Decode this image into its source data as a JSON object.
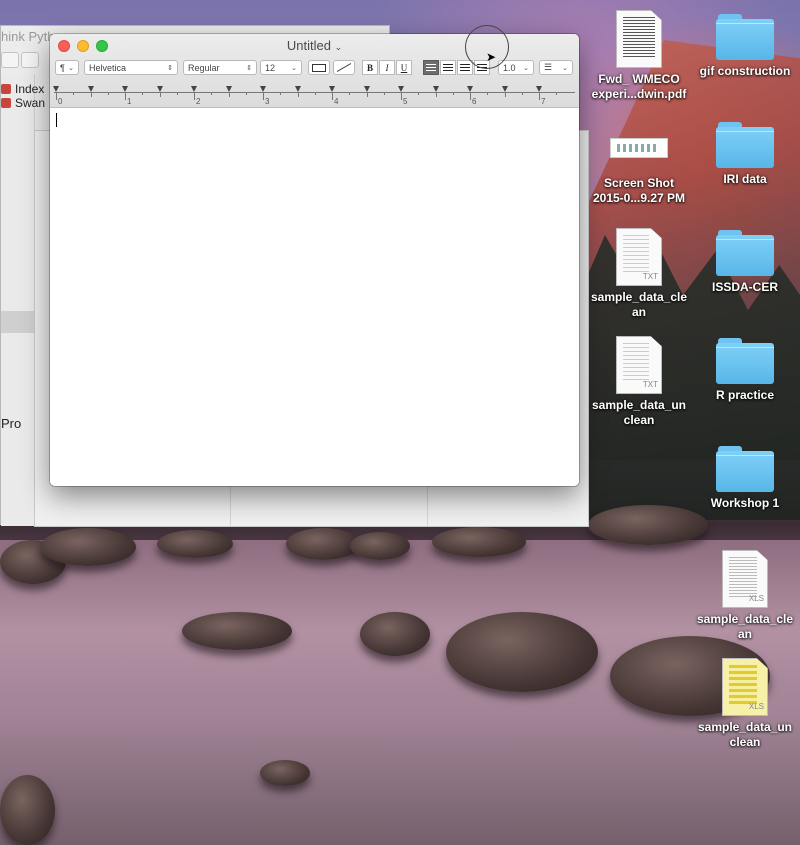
{
  "background_window": {
    "title": "hink Pytho",
    "sidebar_items": [
      "Index",
      "Swan"
    ],
    "footer_text": "Pro"
  },
  "textedit": {
    "title": "Untitled",
    "paragraph_style_label": "¶",
    "font_family": "Helvetica",
    "font_style": "Regular",
    "font_size": "12",
    "bold_label": "B",
    "italic_label": "I",
    "underline_label": "U",
    "line_spacing": "1.0",
    "ruler_numbers": [
      "0",
      "1",
      "2",
      "3",
      "4",
      "5",
      "6",
      "7"
    ]
  },
  "desktop_icons": [
    {
      "label_1": "Fwd_ WMECO",
      "label_2": "experi...dwin.pdf",
      "kind": "pdf-document-icon"
    },
    {
      "label_1": "gif construction",
      "label_2": "",
      "kind": "folder-icon"
    },
    {
      "label_1": "Screen Shot",
      "label_2": "2015-0...9.27 PM",
      "kind": "screenshot-icon"
    },
    {
      "label_1": "IRI data",
      "label_2": "",
      "kind": "folder-icon"
    },
    {
      "label_1": "sample_data_cle",
      "label_2": "an",
      "kind": "txt-document-icon",
      "badge": "TXT"
    },
    {
      "label_1": "ISSDA-CER",
      "label_2": "",
      "kind": "folder-icon"
    },
    {
      "label_1": "sample_data_un",
      "label_2": "clean",
      "kind": "txt-document-icon",
      "badge": "TXT"
    },
    {
      "label_1": "R practice",
      "label_2": "",
      "kind": "folder-icon"
    },
    {
      "label_1": "Workshop 1",
      "label_2": "",
      "kind": "folder-icon"
    },
    {
      "label_1": "sample_data_cle",
      "label_2": "an",
      "kind": "xls-document-icon",
      "badge": "XLS"
    },
    {
      "label_1": "sample_data_un",
      "label_2": "clean",
      "kind": "xls-document-icon",
      "badge": "XLS"
    }
  ],
  "colors": {
    "traffic_close": "#fc5e57",
    "traffic_minimize": "#fdbc2e",
    "traffic_zoom": "#33c748",
    "folder_blue": "#58b6e8"
  }
}
